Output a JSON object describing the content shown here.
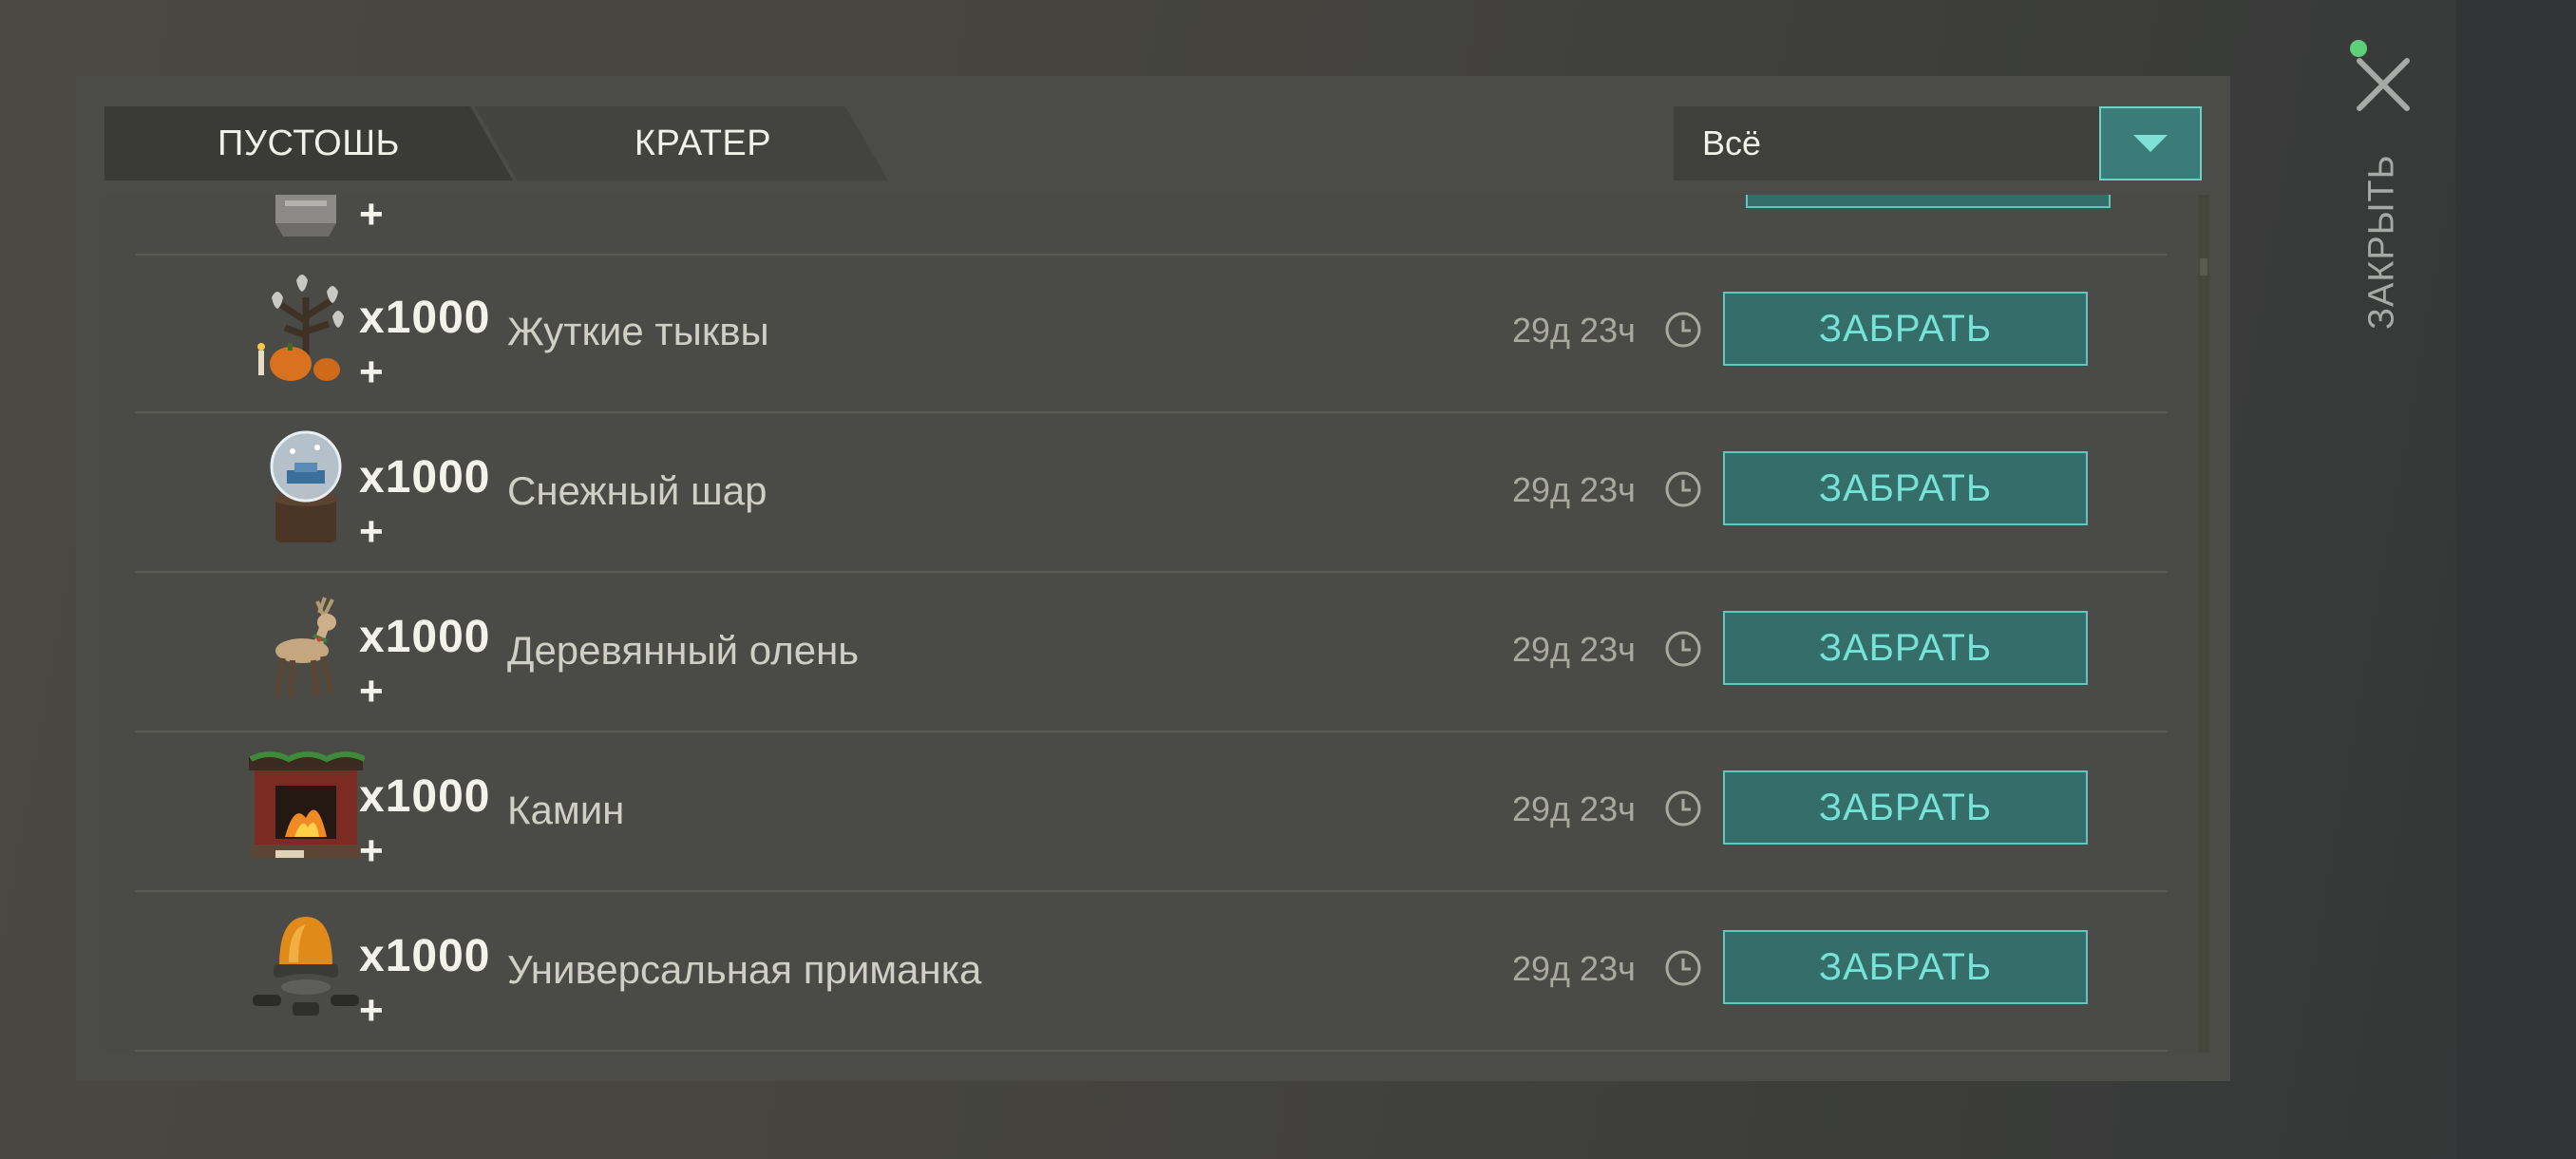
{
  "tabs": [
    {
      "label": "ПУСТОШЬ"
    },
    {
      "label": "КРАТЕР"
    }
  ],
  "filter": {
    "selected": "Всё",
    "arrow_icon": "chevron-down-icon"
  },
  "close": {
    "label": "ЗАКРЫТЬ",
    "icon": "close-icon",
    "status_color": "#5fd07a"
  },
  "partial_row": {
    "plus": "+",
    "icon": "crate-icon"
  },
  "rows": [
    {
      "qty": "x1000",
      "plus": "+",
      "name": "Жуткие тыквы",
      "timer": "29д 23ч",
      "button": "ЗАБРАТЬ",
      "icon": "spooky-pumpkin-tree-icon"
    },
    {
      "qty": "x1000",
      "plus": "+",
      "name": "Снежный шар",
      "timer": "29д 23ч",
      "button": "ЗАБРАТЬ",
      "icon": "snow-globe-icon"
    },
    {
      "qty": "x1000",
      "plus": "+",
      "name": "Деревянный олень",
      "timer": "29д 23ч",
      "button": "ЗАБРАТЬ",
      "icon": "wooden-deer-icon"
    },
    {
      "qty": "x1000",
      "plus": "+",
      "name": "Камин",
      "timer": "29д 23ч",
      "button": "ЗАБРАТЬ",
      "icon": "fireplace-icon"
    },
    {
      "qty": "x1000",
      "plus": "+",
      "name": "Универсальная приманка",
      "timer": "29д 23ч",
      "button": "ЗАБРАТЬ",
      "icon": "beacon-lure-icon"
    }
  ],
  "colors": {
    "accent_teal": "#346d69",
    "accent_teal_border": "#62c4bd",
    "button_text": "#77e2d8",
    "panel_bg": "#4b4b47"
  }
}
